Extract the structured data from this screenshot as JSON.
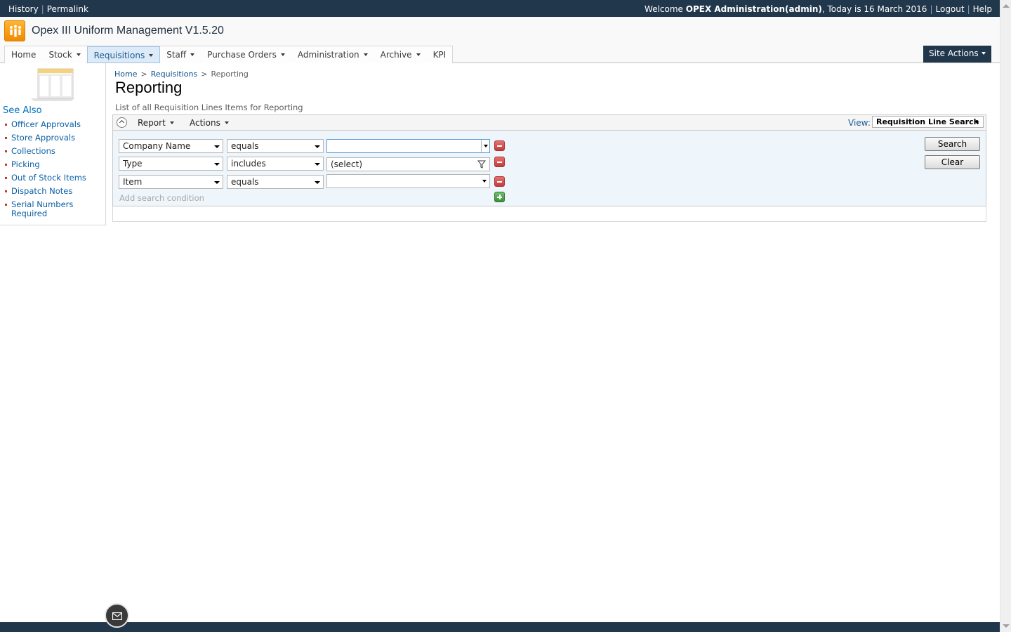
{
  "topbar": {
    "history": "History",
    "permalink": "Permalink",
    "welcome_prefix": "Welcome",
    "user": "OPEX Administration(admin)",
    "date_text": ", Today is 16 March 2016",
    "logout": "Logout",
    "help": "Help"
  },
  "app": {
    "title": "Opex III Uniform Management V1.5.20",
    "brand_color": "#f28a00",
    "logo_icon": "people-icon"
  },
  "nav": {
    "items": [
      {
        "label": "Home",
        "has_menu": false
      },
      {
        "label": "Stock",
        "has_menu": true
      },
      {
        "label": "Requisitions",
        "has_menu": true,
        "active": true
      },
      {
        "label": "Staff",
        "has_menu": true
      },
      {
        "label": "Purchase Orders",
        "has_menu": true
      },
      {
        "label": "Administration",
        "has_menu": true
      },
      {
        "label": "Archive",
        "has_menu": true
      },
      {
        "label": "KPI",
        "has_menu": false
      }
    ],
    "site_actions": "Site Actions"
  },
  "sidebar": {
    "heading": "See Also",
    "items": [
      "Officer Approvals",
      "Store Approvals",
      "Collections",
      "Picking",
      "Out of Stock Items",
      "Dispatch Notes",
      "Serial Numbers Required"
    ]
  },
  "breadcrumb": {
    "home": "Home",
    "section": "Requisitions",
    "current": "Reporting",
    "separator": ">"
  },
  "page": {
    "title": "Reporting",
    "description": "List of all Requisition Lines Items for Reporting"
  },
  "toolbar": {
    "report": "Report",
    "actions": "Actions",
    "view_label": "View:",
    "view_value": "Requisition Line Search"
  },
  "search": {
    "conditions": [
      {
        "field": "Company Name",
        "operator": "equals",
        "value": ""
      },
      {
        "field": "Type",
        "operator": "includes",
        "value": "(select)"
      },
      {
        "field": "Item",
        "operator": "equals",
        "value": ""
      }
    ],
    "add_condition": "Add search condition",
    "search_button": "Search",
    "clear_button": "Clear"
  },
  "colors": {
    "header_dark": "#21374c",
    "active_tab": "#ddeaf8",
    "remove": "#c43c3c",
    "add": "#3c8f3c"
  }
}
